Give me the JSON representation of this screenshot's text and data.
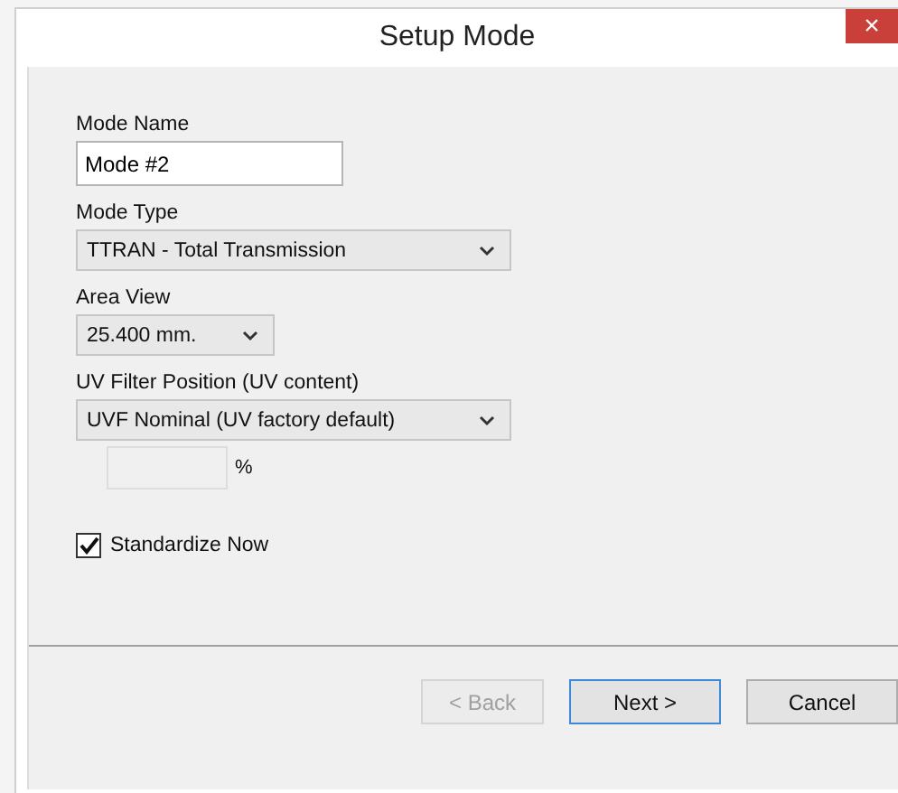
{
  "window": {
    "title": "Setup Mode",
    "close": "×"
  },
  "fields": [
    {
      "kind": "text",
      "label": "Mode Name",
      "value": "Mode #2"
    },
    {
      "kind": "select",
      "label": "Mode Type",
      "value": "TTRAN - Total Transmission",
      "compact": false
    },
    {
      "kind": "select",
      "label": "Area View",
      "value": "25.400 mm.",
      "compact": true
    },
    {
      "kind": "select",
      "label": "UV Filter Position (UV content)",
      "value": "UVF Nominal (UV factory default)",
      "compact": false
    },
    {
      "kind": "percent",
      "unit": "%",
      "disabled": true
    },
    {
      "kind": "checkbox",
      "label": "Standardize Now",
      "checked": true
    }
  ],
  "buttons": [
    {
      "label": "< Back",
      "disabled": true,
      "default": false
    },
    {
      "label": "Next >",
      "disabled": false,
      "default": true
    },
    {
      "label": "Cancel",
      "disabled": false,
      "default": false
    }
  ]
}
